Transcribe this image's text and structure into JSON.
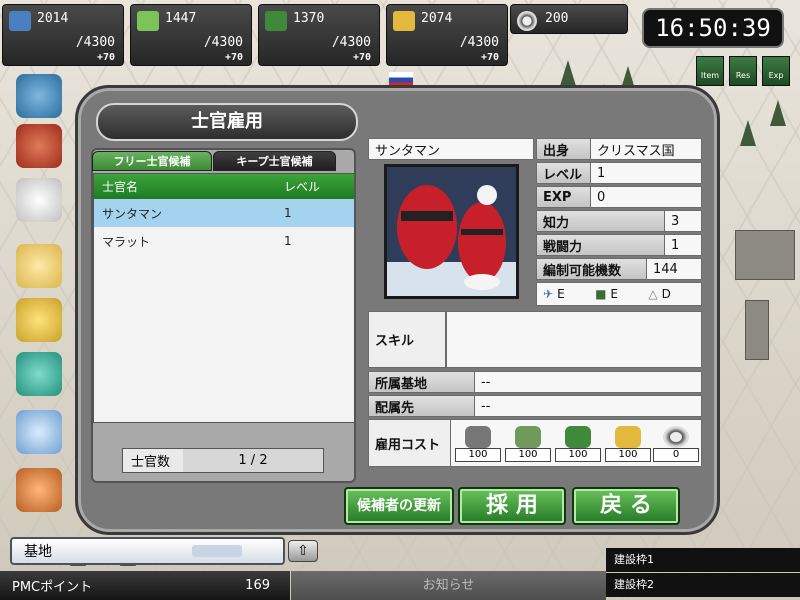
{
  "resources": [
    {
      "name": "fuel",
      "current": "2014",
      "max": "/4300",
      "increment": "+70",
      "color": "#4a80c2"
    },
    {
      "name": "ammo",
      "current": "1447",
      "max": "/4300",
      "increment": "+70",
      "color": "#7cc35a"
    },
    {
      "name": "manpower",
      "current": "1370",
      "max": "/4300",
      "increment": "+70",
      "color": "#3f8a3a"
    },
    {
      "name": "gold",
      "current": "2074",
      "max": "/4300",
      "increment": "+70",
      "color": "#e2b93d"
    },
    {
      "name": "medal",
      "current": "200"
    }
  ],
  "clock": "16:50:39",
  "mini_buttons": [
    "Item",
    "Res",
    "Exp"
  ],
  "panel": {
    "title": "士官雇用",
    "tabs": [
      "フリー士官候補",
      "キープ士官候補"
    ],
    "list_headers": [
      "士官名",
      "レベル"
    ],
    "list_rows": [
      {
        "name": "サンタマン",
        "level": "1",
        "selected": true
      },
      {
        "name": "マラット",
        "level": "1",
        "selected": false
      }
    ],
    "officer_count_label": "士官数",
    "officer_count_value": "1 / 2",
    "officer_name": "サンタマン",
    "details": {
      "origin_label": "出身",
      "origin_value": "クリスマス国",
      "level_label": "レベル",
      "level_value": "1",
      "exp_label": "EXP",
      "exp_value": "0",
      "intel_label": "知力",
      "intel_value": "3",
      "combat_label": "戦闘力",
      "combat_value": "1",
      "units_label": "編制可能機数",
      "units_value": "144"
    },
    "unit_ranks": [
      {
        "icon": "airplane-icon",
        "rank": "E"
      },
      {
        "icon": "tank-icon",
        "rank": "E"
      },
      {
        "icon": "ship-icon",
        "rank": "D"
      }
    ],
    "skill_label": "スキル",
    "base_label": "所属基地",
    "base_value": "--",
    "assign_label": "配属先",
    "assign_value": "--",
    "cost_label": "雇用コスト",
    "costs": [
      "100",
      "100",
      "100",
      "100",
      "0"
    ]
  },
  "buttons": {
    "refresh": "候補者の更新",
    "hire": "採 用",
    "back": "戻 る"
  },
  "bottom": {
    "base_label": "基地",
    "pmc_label": "PMCポイント",
    "pmc_value": "169",
    "news": "お知らせ",
    "build_slot1": "建設枠1",
    "build_slot2": "建設枠2"
  }
}
